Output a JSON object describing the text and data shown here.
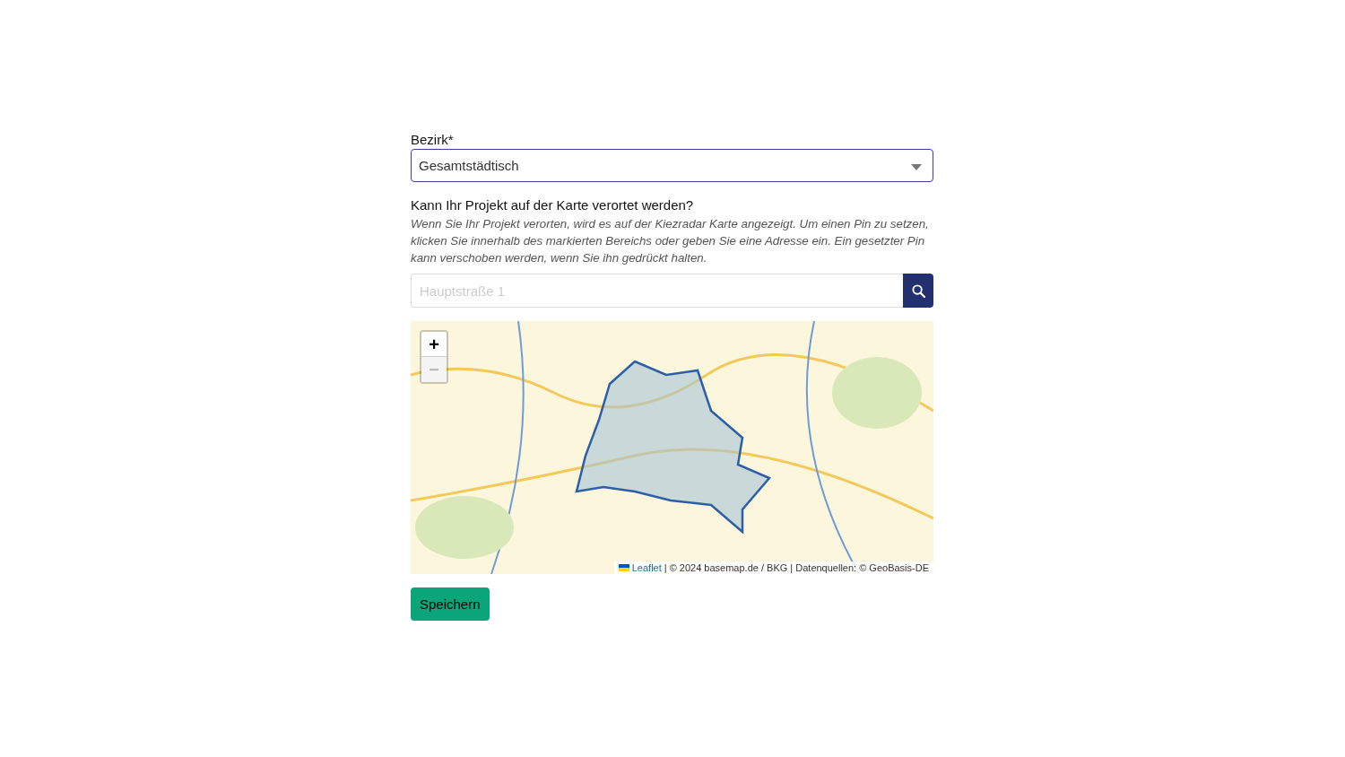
{
  "district": {
    "label": "Bezirk*",
    "value": "Gesamtstädtisch"
  },
  "location": {
    "question": "Kann Ihr Projekt auf der Karte verortet werden?",
    "hint": "Wenn Sie Ihr Projekt verorten, wird es auf der Kiezradar Karte angezeigt. Um einen Pin zu setzen, klicken Sie innerhalb des markierten Bereichs oder geben Sie eine Adresse ein. Ein gesetzter Pin kann verschoben werden, wenn Sie ihn gedrückt halten.",
    "search": {
      "placeholder": "Hauptstraße 1"
    }
  },
  "map": {
    "zoom_controls": [
      {
        "label": "+",
        "disabled": false
      },
      {
        "label": "−",
        "disabled": true
      }
    ],
    "attribution": {
      "link": "Leaflet",
      "text": " | © 2024 basemap.de / BKG | Datenquellen: © GeoBasis-DE"
    }
  },
  "save_button": "Speichern"
}
